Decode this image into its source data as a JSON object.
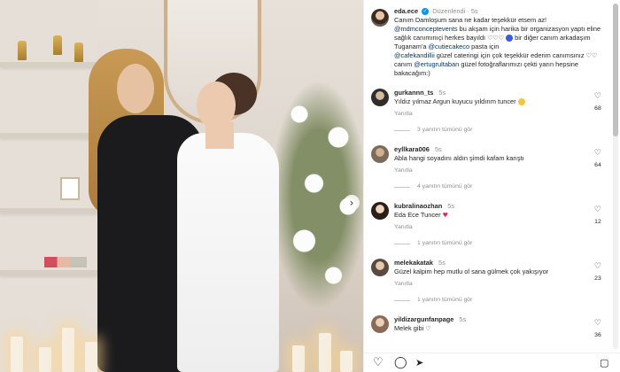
{
  "post": {
    "author": "eda.ece",
    "edited_label": "Düzenlendi",
    "time": "5s",
    "caption_1": "Canım Damloşum sana ne kadar teşekkür etsem az!",
    "mention_1": "@mdmconceptevents",
    "caption_2": " bu akşam için harika bir organizasyon yaptı eline sağlık canımınıçi herkes bayıldı",
    "caption_3": "bir diğer canım arkadaşım Tuganam'a",
    "mention_2": "@cutiecakeco",
    "caption_4": " pasta için",
    "mention_3": "@cafekandillii",
    "caption_5": " güzel cateringi için çok teşekkür ederim canımsınız",
    "caption_6": " canım",
    "mention_4": "@ertugrultaban",
    "caption_7": " güzel fotoğraflarımızı çekti yarın hepsine bakacağım:)"
  },
  "comments": [
    {
      "user": "gurkannn_ts",
      "time": "5s",
      "text": "Yıldız yılmaz Argun kuyucu yıldırım tuncer",
      "reply": "Yanıtla",
      "likes": "68",
      "see_replies": "3 yanıtın tümünü gör"
    },
    {
      "user": "eyllkara006",
      "time": "5s",
      "text": "Abla hangi soyadını aldın şimdi kafam karıştı",
      "reply": "Yanıtla",
      "likes": "64",
      "see_replies": "4 yanıtın tümünü gör"
    },
    {
      "user": "kubralinaozhan",
      "time": "5s",
      "text": "Eda Ece Tuncer",
      "reply": "Yanıtla",
      "likes": "12",
      "see_replies": "1 yanıtın tümünü gör"
    },
    {
      "user": "melekakatak",
      "time": "5s",
      "text": "Güzel kalpim hep mutlu ol sana gülmek çok yakışıyor",
      "reply": "Yanıtla",
      "likes": "23",
      "see_replies": "1 yanıtın tümünü gör"
    },
    {
      "user": "yildizargunfanpage",
      "time": "5s",
      "text": "Melek gibi",
      "likes": "36"
    }
  ],
  "icons": {
    "verified": "verified-badge-icon",
    "like": "heart-outline-icon",
    "comment": "comment-icon",
    "share": "send-icon",
    "save": "bookmark-icon",
    "next": "chevron-right-icon"
  },
  "glyphs": {
    "verified": "✓",
    "heart": "♡",
    "red_heart": "♥",
    "comment": "◯",
    "share": "➤",
    "save": "🔖",
    "next": "›",
    "hearts3": "♡♡♡",
    "hearts2": "♡♡"
  },
  "colors": {
    "link": "#00376b",
    "muted": "#8e8e8e",
    "verified": "#0095f6"
  }
}
